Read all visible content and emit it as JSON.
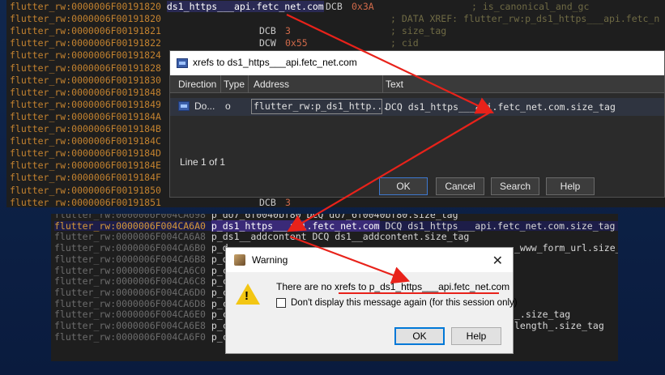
{
  "top_panel": {
    "rows": [
      {
        "addr": "flutter_rw:0000006F00191820",
        "label": "ds1_https___api.fetc_net.com",
        "op": "DCB",
        "val": "0x3A",
        "comment": "; is_canonical_and_gc"
      },
      {
        "addr": "flutter_rw:0000006F00191820",
        "label": "",
        "op": "",
        "val": "",
        "comment": "; DATA XREF: flutter_rw:p_ds1_https___api.fetc_n"
      },
      {
        "addr": "flutter_rw:0000006F00191821",
        "label": "",
        "op": "DCB",
        "val": "3",
        "comment": "; size_tag"
      },
      {
        "addr": "flutter_rw:0000006F00191822",
        "label": "",
        "op": "DCW",
        "val": "0x55",
        "comment": "; cid"
      },
      {
        "addr": "flutter_rw:0000006F00191824",
        "label": "",
        "op": "",
        "val": "",
        "comment": ""
      },
      {
        "addr": "flutter_rw:0000006F00191828",
        "label": "",
        "op": "",
        "val": "",
        "comment": ""
      },
      {
        "addr": "flutter_rw:0000006F00191830",
        "label": "",
        "op": "",
        "val": "",
        "comment": ""
      },
      {
        "addr": "flutter_rw:0000006F00191848",
        "label": "",
        "op": "",
        "val": "",
        "comment": ""
      },
      {
        "addr": "flutter_rw:0000006F00191849",
        "label": "",
        "op": "",
        "val": "",
        "comment": ""
      },
      {
        "addr": "flutter_rw:0000006F0019184A",
        "label": "",
        "op": "",
        "val": "",
        "comment": ""
      },
      {
        "addr": "flutter_rw:0000006F0019184B",
        "label": "",
        "op": "",
        "val": "",
        "comment": ""
      },
      {
        "addr": "flutter_rw:0000006F0019184C",
        "label": "",
        "op": "",
        "val": "",
        "comment": ""
      },
      {
        "addr": "flutter_rw:0000006F0019184D",
        "label": "",
        "op": "",
        "val": "",
        "comment": ""
      },
      {
        "addr": "flutter_rw:0000006F0019184E",
        "label": "",
        "op": "",
        "val": "",
        "comment": ""
      },
      {
        "addr": "flutter_rw:0000006F0019184F",
        "label": "",
        "op": "",
        "val": "",
        "comment": ""
      },
      {
        "addr": "flutter_rw:0000006F00191850",
        "label": "",
        "op": "",
        "val": "",
        "comment": ""
      },
      {
        "addr": "flutter_rw:0000006F00191851",
        "label": "",
        "op": "DCB",
        "val": "3",
        "comment": ""
      }
    ]
  },
  "xref_dialog": {
    "title": "xrefs to ds1_https___api.fetc_net.com",
    "columns": [
      "Direction",
      "Type",
      "Address",
      "Text"
    ],
    "row": {
      "direction": "Do...",
      "type": "o",
      "address": "flutter_rw:p_ds1_http...",
      "text": "DCQ ds1_https___api.fetc_net.com.size_tag"
    },
    "status": "Line 1 of 1",
    "buttons": [
      "OK",
      "Cancel",
      "Search",
      "Help"
    ]
  },
  "bottom_panel": {
    "rows": [
      {
        "addr": "flutter_rw:0000006F004CA698",
        "text": "p_do7_6f0040bf80 DCQ do7_6f0040bf80.size_tag",
        "style": "dim"
      },
      {
        "addr": "flutter_rw:0000006F004CA6A0",
        "label": "p_ds1_https___api.fetc_net.com",
        "text": " DCQ ds1_https___api.fetc_net.com.size_tag",
        "style": "sel"
      },
      {
        "addr": "flutter_rw:0000006F004CA6A8",
        "text": "p_ds1__addcontent DCQ ds1__addcontent.size_tag",
        "style": "dim"
      },
      {
        "addr": "flutter_rw:0000006F004CA6B0",
        "text": "p_d",
        "right": "_www_form_url.size_t",
        "style": "dim"
      },
      {
        "addr": "flutter_rw:0000006F004CA6B8",
        "text": "p_d",
        "right": "",
        "style": "dim"
      },
      {
        "addr": "flutter_rw:0000006F004CA6C0",
        "text": "p_c",
        "right": "",
        "style": "dim"
      },
      {
        "addr": "flutter_rw:0000006F004CA6C8",
        "text": "p_c",
        "right": "",
        "style": "dim"
      },
      {
        "addr": "flutter_rw:0000006F004CA6D0",
        "text": "p_c",
        "right": "",
        "style": "dim"
      },
      {
        "addr": "flutter_rw:0000006F004CA6D8",
        "text": "p_c",
        "right": "",
        "style": "dim"
      },
      {
        "addr": "flutter_rw:0000006F004CA6E0",
        "text": "p_c",
        "right": "_.size_tag",
        "style": "dim"
      },
      {
        "addr": "flutter_rw:0000006F004CA6E8",
        "text": "p_c",
        "right": "length_.size_tag",
        "style": "dim"
      },
      {
        "addr": "flutter_rw:0000006F004CA6F0",
        "text": "p_c",
        "right": "",
        "style": "dim"
      }
    ]
  },
  "warning_dialog": {
    "title": "Warning",
    "message": "There are no xrefs to p_ds1_https___api.fetc_net.com",
    "checkbox_label": "Don't display this message again (for this session only)",
    "ok": "OK",
    "help": "Help"
  },
  "colors": {
    "arrow": "#e8221a",
    "address": "#c3822f",
    "selection": "#3a2a78"
  }
}
